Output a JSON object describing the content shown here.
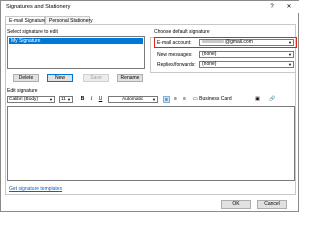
{
  "window": {
    "title": "Signatures and Stationery",
    "help": "?",
    "close": "✕"
  },
  "tabs": [
    {
      "label": "E-mail Signature"
    },
    {
      "label": "Personal Stationery"
    }
  ],
  "select_signature": {
    "label": "Select signature to edit",
    "items": [
      "My Signature"
    ]
  },
  "buttons": {
    "delete": "Delete",
    "new": "New",
    "save": "Save",
    "rename": "Rename"
  },
  "default_signature": {
    "label": "Choose default signature",
    "email_label": "E-mail account:",
    "email_value": "@gmail.com",
    "new_messages_label": "New messages:",
    "new_messages_value": "(none)",
    "replies_label": "Replies/forwards:",
    "replies_value": "(none)"
  },
  "edit_signature": {
    "label": "Edit signature",
    "font": "Calibri (Body)",
    "size": "11",
    "color": "Automatic",
    "business_card": "Business Card"
  },
  "footer": {
    "templates_link": "Get signature templates",
    "ok": "OK",
    "cancel": "Cancel"
  },
  "colors": {
    "accent": "#0078d7",
    "highlight": "#e0251b",
    "link": "#0066cc"
  }
}
